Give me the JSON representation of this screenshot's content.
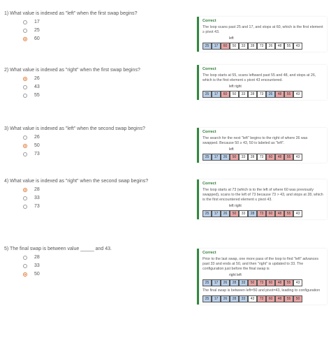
{
  "questions": [
    {
      "prompt": "1)  What value is indexed as \"left\" when the first swap begins?",
      "options": [
        "17",
        "25",
        "60"
      ],
      "selected": 2
    },
    {
      "prompt": "2)  What value is indexed as \"right\" when the first swap begins?",
      "options": [
        "26",
        "43",
        "55"
      ],
      "selected": 0
    },
    {
      "prompt": "3)  What value is indexed as \"left\" when the second swap begins?",
      "options": [
        "26",
        "50",
        "73"
      ],
      "selected": 1
    },
    {
      "prompt": "4)  What value is indexed as \"right\" when the second swap begins?",
      "options": [
        "28",
        "33",
        "73"
      ],
      "selected": 0
    },
    {
      "prompt": "5)  The final swap is between value _____ and 43.",
      "options": [
        "28",
        "33",
        "50"
      ],
      "selected": 2
    }
  ],
  "feedback": [
    {
      "title": "Correct",
      "text": "The loop scans past 25 and 17, and stops at 60, which is the first element ≥ pivot 43.",
      "pointers": "left",
      "array": [
        "25",
        "17",
        "60",
        "50",
        "33",
        "28",
        "73",
        "26",
        "48",
        "55",
        "43"
      ],
      "colors": [
        "b",
        "b",
        "r",
        "",
        "",
        "",
        "",
        "",
        "",
        "",
        ""
      ]
    },
    {
      "title": "Correct",
      "text": "The loop starts at 55, scans leftward past 55 and 48, and stops at 26, which is the first element ≤ pivot 43 encountered.",
      "pointers": "left                right",
      "array": [
        "25",
        "17",
        "60",
        "50",
        "33",
        "28",
        "73",
        "26",
        "48",
        "55",
        "43"
      ],
      "colors": [
        "b",
        "b",
        "r",
        "",
        "",
        "",
        "",
        "b",
        "r",
        "r",
        ""
      ]
    },
    {
      "title": "Correct",
      "text": "The search for the next \"left\" begins to the right of where 26 was swapped. Because 50 ≥ 43, 50 is labeled as \"left\".",
      "pointers": "left",
      "array": [
        "25",
        "17",
        "26",
        "50",
        "33",
        "28",
        "73",
        "60",
        "48",
        "55",
        "43"
      ],
      "colors": [
        "b",
        "b",
        "b",
        "r",
        "",
        "",
        "",
        "r",
        "r",
        "r",
        ""
      ]
    },
    {
      "title": "Correct",
      "text": "The loop starts at 73 (which is to the left of where 60 was previously swapped), scans to the left of 73 because 73 > 43, and stops at 28, which is the first encountered element ≤ pivot 43.",
      "pointers": "left   right",
      "array": [
        "25",
        "17",
        "26",
        "50",
        "33",
        "28",
        "73",
        "60",
        "48",
        "55",
        "43"
      ],
      "colors": [
        "b",
        "b",
        "b",
        "r",
        "",
        "b",
        "r",
        "r",
        "r",
        "r",
        ""
      ]
    },
    {
      "title": "Correct",
      "text": "Prior to the last swap, one more pass of the loop to find \"left\" advances past 33 and ends at 50, and then \"right\" is updated to 33. The configuration just before the final swap is",
      "pointers": "right  left",
      "array": [
        "25",
        "17",
        "26",
        "28",
        "33",
        "50",
        "73",
        "60",
        "48",
        "55",
        "43"
      ],
      "colors": [
        "b",
        "b",
        "b",
        "b",
        "b",
        "r",
        "r",
        "r",
        "r",
        "r",
        ""
      ],
      "extra": "The final swap is between left=50 and pivot=43, leading to configuration",
      "array2": [
        "25",
        "17",
        "26",
        "28",
        "33",
        "43",
        "73",
        "60",
        "48",
        "55",
        "50"
      ],
      "colors2": [
        "b",
        "b",
        "b",
        "b",
        "b",
        "",
        "r",
        "r",
        "r",
        "r",
        "r"
      ]
    }
  ]
}
